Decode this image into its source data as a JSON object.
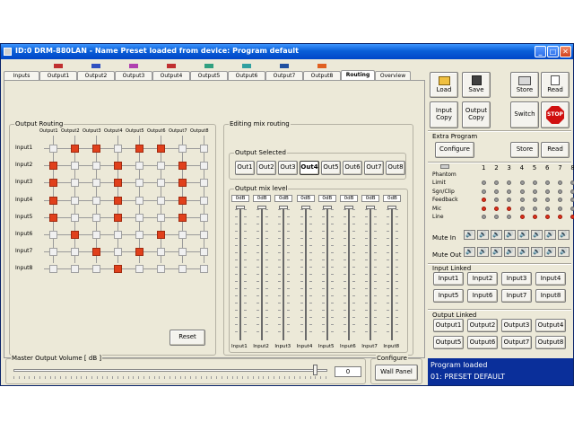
{
  "window": {
    "title": "ID:0 DRM-880LAN - Name Preset loaded from device: Program default"
  },
  "tabs": [
    {
      "label": "Inputs",
      "color": ""
    },
    {
      "label": "Output1",
      "color": "#c03030"
    },
    {
      "label": "Output2",
      "color": "#3050c0"
    },
    {
      "label": "Output3",
      "color": "#b040b0"
    },
    {
      "label": "Output4",
      "color": "#c03030"
    },
    {
      "label": "Output5",
      "color": "#30a080"
    },
    {
      "label": "Output6",
      "color": "#30a0a0"
    },
    {
      "label": "Output7",
      "color": "#2050a0"
    },
    {
      "label": "Output8",
      "color": "#e06020"
    },
    {
      "label": "Routing",
      "color": ""
    },
    {
      "label": "Overview",
      "color": ""
    }
  ],
  "routing": {
    "title": "Output Routing",
    "col_labels": [
      "Output1",
      "Output2",
      "Output3",
      "Output4",
      "Output5",
      "Output6",
      "Output7",
      "Output8"
    ],
    "row_labels": [
      "Input1",
      "Input2",
      "Input3",
      "Input4",
      "Input5",
      "Input6",
      "Input7",
      "Input8"
    ],
    "matrix": [
      [
        0,
        1,
        1,
        0,
        1,
        1,
        0,
        0
      ],
      [
        1,
        0,
        0,
        1,
        0,
        0,
        1,
        0
      ],
      [
        1,
        0,
        0,
        1,
        0,
        0,
        1,
        0
      ],
      [
        1,
        0,
        0,
        1,
        0,
        0,
        1,
        0
      ],
      [
        1,
        0,
        0,
        1,
        0,
        0,
        1,
        0
      ],
      [
        0,
        1,
        0,
        0,
        0,
        1,
        0,
        0
      ],
      [
        0,
        0,
        1,
        0,
        1,
        0,
        0,
        0
      ],
      [
        0,
        0,
        0,
        1,
        0,
        0,
        0,
        0
      ]
    ],
    "reset_label": "Reset"
  },
  "mix": {
    "title": "Editing mix routing",
    "selected_title": "Output Selected",
    "outputs": [
      "Out1",
      "Out2",
      "Out3",
      "Out4",
      "Out5",
      "Out6",
      "Out7",
      "Out8"
    ],
    "selected_index": 3,
    "level_title": "Output mix level",
    "levels": [
      "0dB",
      "0dB",
      "0dB",
      "0dB",
      "0dB",
      "0dB",
      "0dB",
      "0dB"
    ],
    "fader_values": [
      1,
      1,
      1,
      1,
      1,
      1,
      1,
      1
    ],
    "fader_labels": [
      "Input1",
      "Input2",
      "Input3",
      "Input4",
      "Input5",
      "Input6",
      "Input7",
      "Input8"
    ]
  },
  "master": {
    "title": "Master Output Volume [ dB ]",
    "value": "0",
    "slider_fraction": 0.96
  },
  "configure": {
    "title": "Configure",
    "wall_panel_label": "Wall Panel"
  },
  "toolbar": {
    "load_label": "Load",
    "save_label": "Save",
    "store_label": "Store",
    "read_label": "Read",
    "input_copy_label": "Input Copy",
    "output_copy_label": "Output Copy",
    "switch_label": "Switch",
    "stop_label": "STOP"
  },
  "extra": {
    "title": "Extra Program",
    "configure_label": "Configure",
    "store_label": "Store",
    "read_label": "Read"
  },
  "indicators": {
    "columns": [
      "1",
      "2",
      "3",
      "4",
      "5",
      "6",
      "7",
      "8"
    ],
    "rows": [
      {
        "label": "Phantom",
        "states": [
          0,
          0,
          0,
          0,
          0,
          0,
          0,
          0
        ],
        "hidden_dots": true
      },
      {
        "label": "Limit",
        "states": [
          0,
          0,
          0,
          0,
          0,
          0,
          0,
          0
        ]
      },
      {
        "label": "Sgn/Clip",
        "states": [
          0,
          0,
          0,
          0,
          0,
          0,
          0,
          0
        ]
      },
      {
        "label": "Feedback",
        "states": [
          1,
          0,
          0,
          0,
          0,
          0,
          0,
          0
        ]
      },
      {
        "label": "Mic",
        "states": [
          1,
          1,
          1,
          0,
          0,
          0,
          0,
          0
        ]
      },
      {
        "label": "Line",
        "states": [
          0,
          0,
          0,
          1,
          1,
          1,
          1,
          1
        ]
      }
    ],
    "mute_in_label": "Mute In",
    "mute_out_label": "Mute Out"
  },
  "input_linked": {
    "title": "Input Linked",
    "items": [
      "Input1",
      "Input2",
      "Input3",
      "Input4",
      "Input5",
      "Input6",
      "Input7",
      "Input8"
    ]
  },
  "output_linked": {
    "title": "Output Linked",
    "items": [
      "Output1",
      "Output2",
      "Output3",
      "Output4",
      "Output5",
      "Output6",
      "Output7",
      "Output8"
    ]
  },
  "status": {
    "line1": "Program loaded",
    "line2": "01: PRESET DEFAULT"
  }
}
